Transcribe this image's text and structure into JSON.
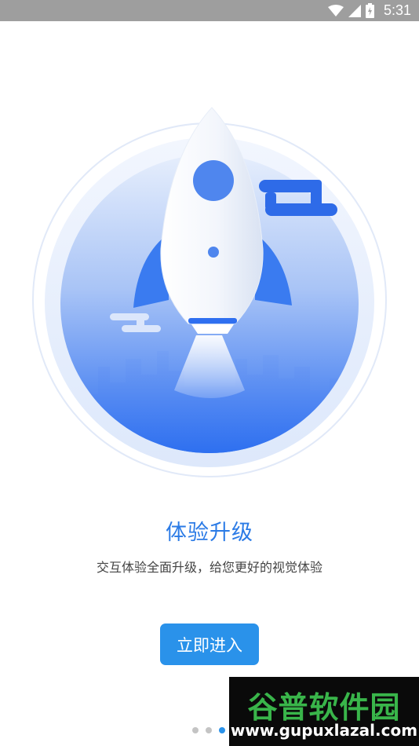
{
  "status_bar": {
    "time": "5:31",
    "icons": [
      "wifi-icon",
      "cellular-signal-icon",
      "battery-charging-icon"
    ]
  },
  "onboarding": {
    "illustration": "rocket-launch-illustration",
    "title": "体验升级",
    "subtitle": "交互体验全面升级，给您更好的视觉体验",
    "enter_button_label": "立即进入",
    "page_indicator": {
      "total": 3,
      "active_index": 2
    }
  },
  "watermark": {
    "line1": "谷普软件园",
    "line2": "www.gupuxlazal.com"
  },
  "colors": {
    "accent": "#2a92ea",
    "title": "#2b7be6",
    "status_bar": "#9e9e9e"
  }
}
